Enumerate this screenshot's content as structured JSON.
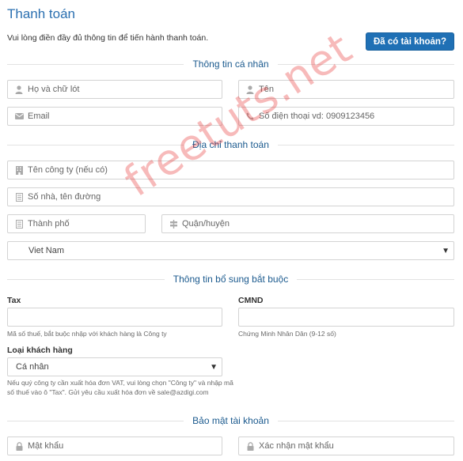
{
  "header": {
    "title": "Thanh toán",
    "intro": "Vui lòng điền đầy đủ thông tin để tiến hành thanh toán.",
    "login_button": "Đã có tài khoản?"
  },
  "sections": {
    "personal": "Thông tin cá nhân",
    "billing": "Địa chỉ thanh toán",
    "extra": "Thông tin bổ sung bắt buộc",
    "security": "Bảo mật tài khoản"
  },
  "personal": {
    "fullname_placeholder": "Họ và chữ lót",
    "firstname_placeholder": "Tên",
    "email_placeholder": "Email",
    "phone_placeholder": "Số điện thoại vd: 0909123456"
  },
  "billing": {
    "company_placeholder": "Tên công ty (nếu có)",
    "address_placeholder": "Số nhà, tên đường",
    "city_placeholder": "Thành phố",
    "district_placeholder": "Quận/huyện",
    "country_value": "Viet Nam"
  },
  "extra": {
    "tax_label": "Tax",
    "tax_help": "Mã số thuế, bắt buộc nhập với khách hàng là Công ty",
    "cmnd_label": "CMND",
    "cmnd_help": "Chứng Minh Nhân Dân (9-12 số)",
    "customer_type_label": "Loại khách hàng",
    "customer_type_value": "Cá nhân",
    "customer_type_help_1": "Nếu quý công ty cần xuất hóa đơn VAT, vui lòng chọn \"Công ty\" và nhập mã",
    "customer_type_help_2": "số thuế vào ô \"Tax\". Gửi yêu cầu xuất hóa đơn về sale@azdigi.com"
  },
  "security": {
    "password_placeholder": "Mật khẩu",
    "confirm_placeholder": "Xác nhận mật khẩu"
  },
  "watermark": "freetuts.net",
  "colors": {
    "accent": "#1f70b5",
    "title": "#2a6fb0",
    "section": "#1b5a8e",
    "watermark": "#e62828"
  }
}
